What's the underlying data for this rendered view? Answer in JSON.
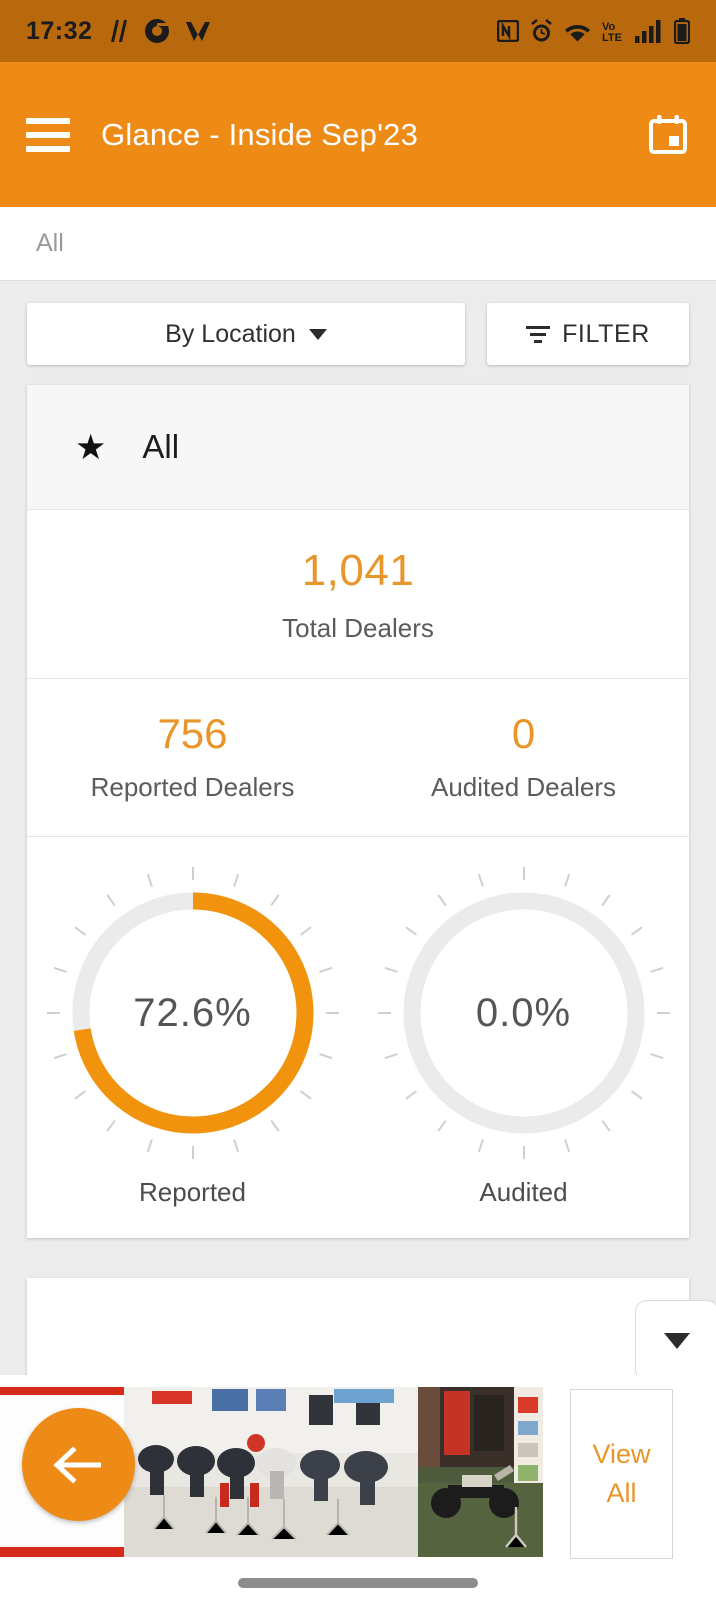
{
  "status_bar": {
    "time": "17:32",
    "left_icons": [
      "nfc-pay-icon",
      "chrome-icon",
      "m-app-icon"
    ],
    "right_icons": [
      "nfc-icon",
      "alarm-icon",
      "wifi-icon",
      "volte-icon",
      "signal-icon",
      "battery-icon"
    ],
    "background_color": "#b8690d"
  },
  "app_bar": {
    "menu_icon": "hamburger-menu-icon",
    "title": "Glance - Inside Sep'23",
    "calendar_icon": "calendar-icon",
    "background_color": "#ee8b16"
  },
  "breadcrumb": {
    "text": "All"
  },
  "filters": {
    "location_label": "By Location",
    "location_caret": "chevron-down-icon",
    "filter_label": "FILTER",
    "filter_icon": "filter-list-icon"
  },
  "card": {
    "star_icon": "★",
    "header_label": "All",
    "total": {
      "value": "1,041",
      "label": "Total Dealers"
    },
    "stats": [
      {
        "value": "756",
        "label": "Reported Dealers"
      },
      {
        "value": "0",
        "label": "Audited Dealers"
      }
    ]
  },
  "chart_data": {
    "type": "pie",
    "title": "Dealer coverage gauges",
    "legend_position": "below",
    "gauges": [
      {
        "name": "Reported",
        "value": 72.6,
        "display": "72.6%",
        "caption": "Reported",
        "max": 100,
        "arc_color": "#f2930e",
        "track_color": "#ebebeb",
        "tick_count": 20
      },
      {
        "name": "Audited",
        "value": 0.0,
        "display": "0.0%",
        "caption": "Audited",
        "max": 100,
        "arc_color": "#f2930e",
        "track_color": "#ebebeb",
        "tick_count": 20
      }
    ]
  },
  "second_card": {
    "dropdown_icon": "chevron-down-icon"
  },
  "photo_bar": {
    "back_icon": "arrow-left-icon",
    "view_all_line1": "View",
    "view_all_line2": "All",
    "photos": [
      "dealer-photo-red-banner",
      "dealer-photo-scooter-showroom",
      "dealer-photo-motorcycle-outdoor"
    ]
  },
  "colors": {
    "accent": "#e8962a",
    "app_bar": "#ee8b16",
    "status_bar": "#b8690d",
    "page_bg": "#ececec"
  }
}
